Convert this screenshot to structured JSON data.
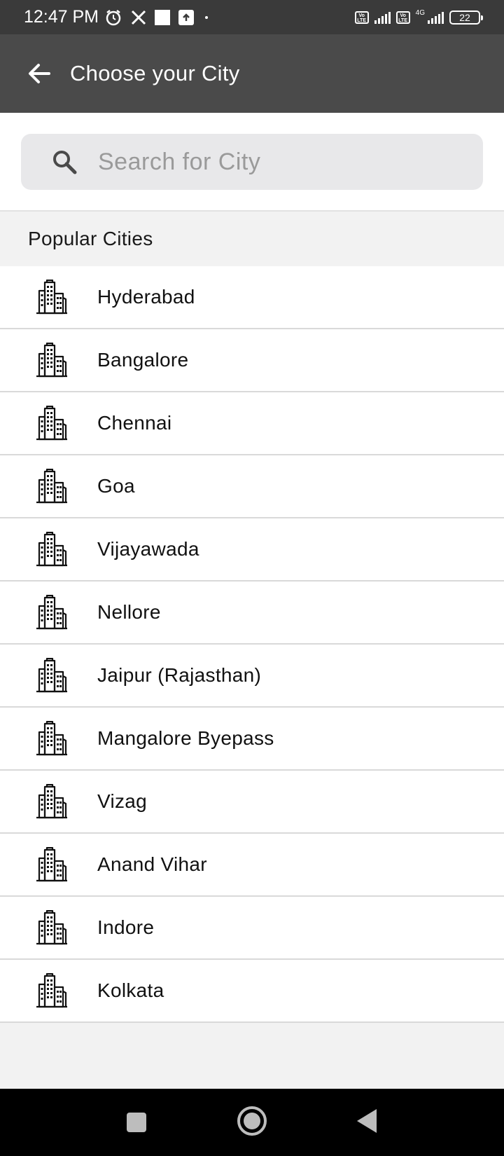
{
  "status_bar": {
    "time": "12:47 PM",
    "network_label": "4G",
    "battery": "22",
    "volte_label": "Vo LTE"
  },
  "app_bar": {
    "title": "Choose your City",
    "back_icon": "arrow-left-icon"
  },
  "search": {
    "placeholder": "Search for City",
    "value": "",
    "icon": "search-icon"
  },
  "popular": {
    "heading": "Popular Cities",
    "cities": [
      {
        "name": "Hyderabad"
      },
      {
        "name": "Bangalore"
      },
      {
        "name": "Chennai"
      },
      {
        "name": "Goa"
      },
      {
        "name": "Vijayawada"
      },
      {
        "name": "Nellore"
      },
      {
        "name": "Jaipur (Rajasthan)"
      },
      {
        "name": "Mangalore Byepass"
      },
      {
        "name": "Vizag"
      },
      {
        "name": "Anand Vihar"
      },
      {
        "name": "Indore"
      },
      {
        "name": "Kolkata"
      }
    ],
    "city_icon": "city-buildings-icon"
  },
  "colors": {
    "status_bar_bg": "#3a3a3a",
    "app_bar_bg": "#4a4a4a",
    "search_box_bg": "#e8e8ea",
    "page_bg": "#f2f2f2",
    "nav_bar_bg": "#000000"
  }
}
